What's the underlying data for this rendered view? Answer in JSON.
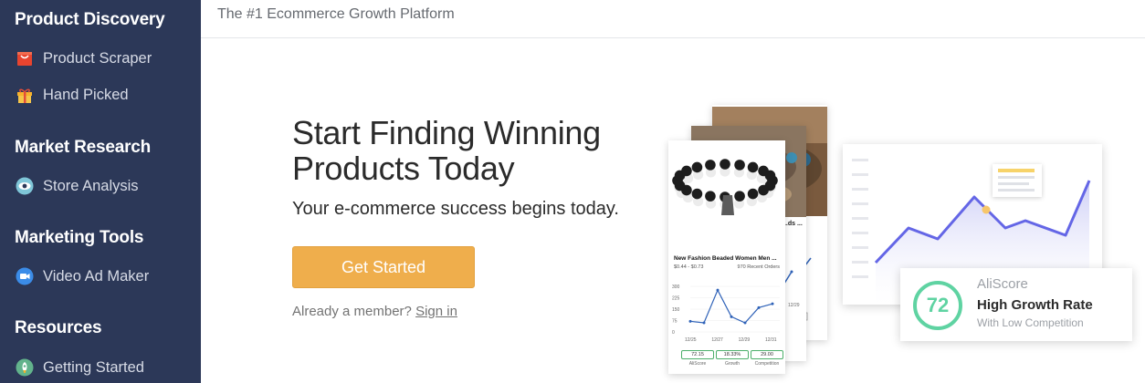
{
  "sidebar": {
    "sections": [
      {
        "heading": "Product Discovery",
        "items": [
          {
            "label": "Product Scraper",
            "icon": "shopping-bag-icon"
          },
          {
            "label": "Hand Picked",
            "icon": "gift-icon"
          }
        ]
      },
      {
        "heading": "Market Research",
        "items": [
          {
            "label": "Store Analysis",
            "icon": "eye-icon"
          }
        ]
      },
      {
        "heading": "Marketing Tools",
        "items": [
          {
            "label": "Video Ad Maker",
            "icon": "video-camera-icon"
          }
        ]
      },
      {
        "heading": "Resources",
        "items": [
          {
            "label": "Getting Started",
            "icon": "rocket-icon"
          }
        ]
      }
    ]
  },
  "topbar": {
    "tagline": "The #1 Ecommerce Growth Platform"
  },
  "hero": {
    "title": "Start Finding Winning Products Today",
    "subtitle": "Your e-commerce success begins today.",
    "cta_label": "Get Started",
    "member_prompt": "Already a member?",
    "sign_in_label": "Sign in"
  },
  "product_card": {
    "name": "New Fashion Beaded Women Men ...",
    "price": "$0.44 - $0.73",
    "orders": "970 Recent Orders",
    "back_card_name": "...ds ...",
    "back_card_date": "12/29",
    "stats": [
      {
        "value": "72.15",
        "label": "AliScore"
      },
      {
        "value": "18.33%",
        "label": "Growth"
      },
      {
        "value": "29.00",
        "label": "Competition"
      }
    ],
    "chart": {
      "y_ticks": [
        "300",
        "225",
        "150",
        "75",
        "0"
      ],
      "x_ticks": [
        "12/25",
        "12/27",
        "12/29",
        "12/31"
      ],
      "values": [
        70,
        60,
        275,
        100,
        60,
        160,
        185
      ]
    }
  },
  "aliscore": {
    "score": "72",
    "title": "AliScore",
    "rating": "High Growth Rate",
    "note": "With Low Competition"
  },
  "colors": {
    "sidebar_bg": "#2c3858",
    "cta": "#efae4c",
    "score_green": "#5fd3a2",
    "chart_line": "#6466e6"
  }
}
